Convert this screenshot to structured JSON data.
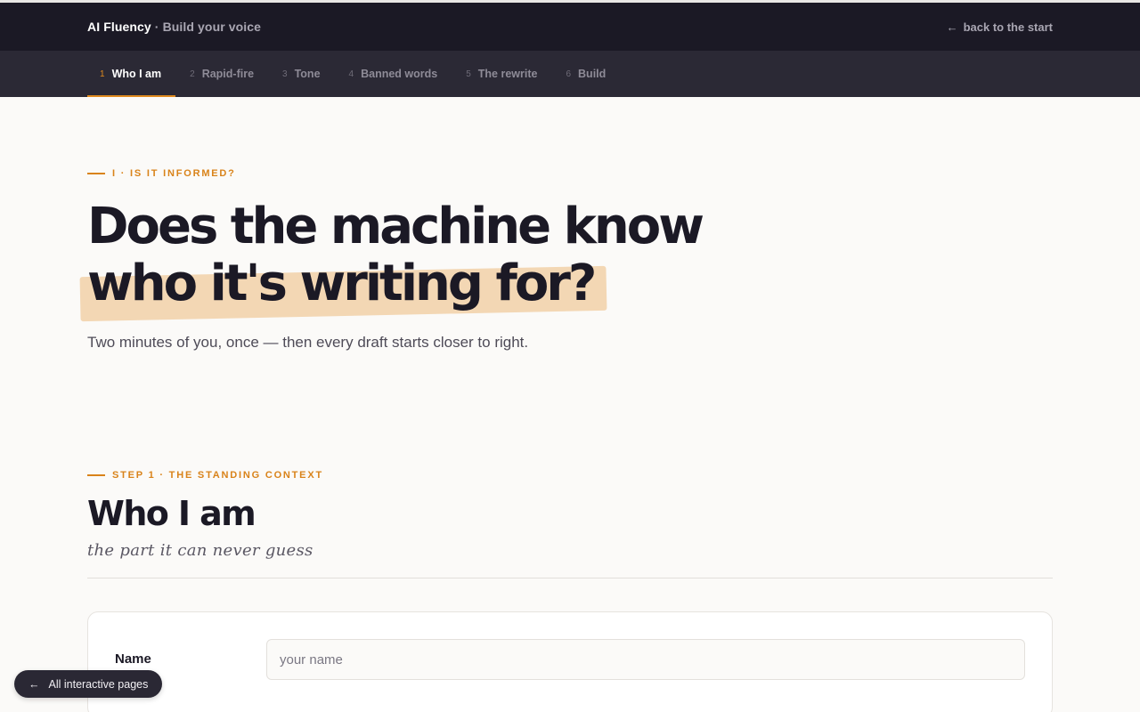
{
  "header": {
    "brand": "AI Fluency",
    "separator": "·",
    "subtitle": "Build your voice",
    "back_arrow": "←",
    "back_label": "back to the start"
  },
  "steps": [
    {
      "num": "1",
      "label": "Who I am",
      "active": true
    },
    {
      "num": "2",
      "label": "Rapid-fire",
      "active": false
    },
    {
      "num": "3",
      "label": "Tone",
      "active": false
    },
    {
      "num": "4",
      "label": "Banned words",
      "active": false
    },
    {
      "num": "5",
      "label": "The rewrite",
      "active": false
    },
    {
      "num": "6",
      "label": "Build",
      "active": false
    }
  ],
  "hero": {
    "eyebrow": "I · IS IT INFORMED?",
    "title_line1": "Does the machine know",
    "title_line2": "who it's writing for?",
    "subtitle": "Two minutes of you, once — then every draft starts closer to right."
  },
  "section": {
    "eyebrow": "STEP 1 · THE STANDING CONTEXT",
    "title": "Who I am",
    "subtitle": "the part it can never guess"
  },
  "form": {
    "name_label": "Name",
    "name_placeholder": "your name",
    "name_value": ""
  },
  "pill": {
    "arrow": "←",
    "label": "All interactive pages"
  },
  "colors": {
    "accent": "#e08a1e",
    "header_bg": "#1b1925",
    "nav_bg": "#2b2935",
    "highlight": "#f3d7b4",
    "page_bg": "#fbfaf8"
  }
}
